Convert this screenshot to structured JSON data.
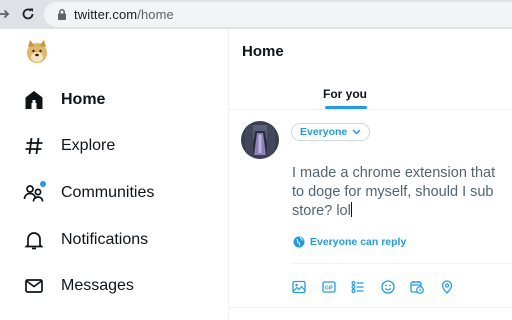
{
  "browser": {
    "url_host": "twitter.com",
    "url_path": "/home",
    "back_icon": "arrow-right-icon",
    "reload_icon": "reload-icon",
    "lock_icon": "lock-icon"
  },
  "sidebar": {
    "logo_icon": "doge-avatar-icon",
    "items": [
      {
        "label": "Home",
        "icon": "home-icon",
        "active": true
      },
      {
        "label": "Explore",
        "icon": "hashtag-icon",
        "active": false
      },
      {
        "label": "Communities",
        "icon": "communities-icon",
        "active": false,
        "badge_dot": true
      },
      {
        "label": "Notifications",
        "icon": "bell-icon",
        "active": false
      },
      {
        "label": "Messages",
        "icon": "envelope-icon",
        "active": false
      }
    ]
  },
  "main": {
    "title": "Home",
    "tabs": [
      {
        "label": "For you",
        "active": true
      }
    ],
    "composer": {
      "audience_label": "Everyone",
      "text_lines": [
        "I made a chrome extension that",
        "to doge for myself, should I sub",
        "store? lol"
      ],
      "reply_setting_label": "Everyone can reply",
      "tools": [
        "image-icon",
        "gif-icon",
        "poll-icon",
        "emoji-icon",
        "schedule-icon",
        "location-icon"
      ]
    }
  },
  "colors": {
    "accent": "#1d9bf0",
    "text": "#0f1419",
    "muted": "#536471",
    "divider": "#eff3f4",
    "chrome": "#dee1e6"
  }
}
